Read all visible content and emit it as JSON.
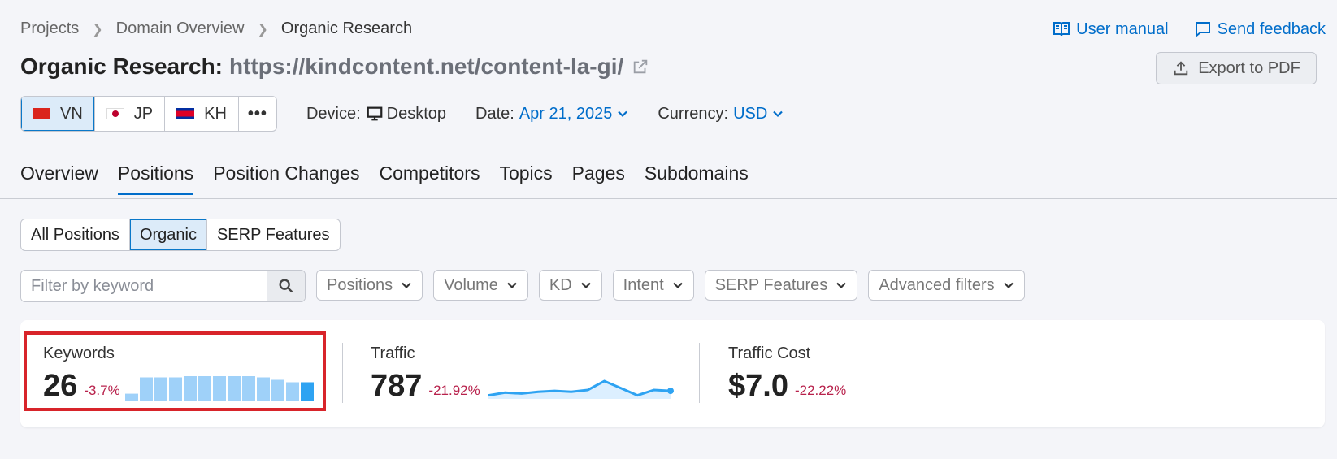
{
  "breadcrumb": {
    "items": [
      "Projects",
      "Domain Overview",
      "Organic Research"
    ]
  },
  "top_links": {
    "manual": "User manual",
    "feedback": "Send feedback"
  },
  "title": {
    "prefix": "Organic Research:",
    "url": "https://kindcontent.net/content-la-gi/"
  },
  "export_label": "Export to PDF",
  "databases": [
    {
      "code": "VN",
      "flag": "vn",
      "active": true
    },
    {
      "code": "JP",
      "flag": "jp",
      "active": false
    },
    {
      "code": "KH",
      "flag": "kh",
      "active": false
    }
  ],
  "more_label": "•••",
  "device": {
    "label": "Device:",
    "value": "Desktop",
    "icon": "monitor-icon"
  },
  "date": {
    "label": "Date:",
    "value": "Apr 21, 2025"
  },
  "currency": {
    "label": "Currency:",
    "value": "USD"
  },
  "tabs": [
    "Overview",
    "Positions",
    "Position Changes",
    "Competitors",
    "Topics",
    "Pages",
    "Subdomains"
  ],
  "active_tab": "Positions",
  "segments": [
    "All Positions",
    "Organic",
    "SERP Features"
  ],
  "active_segment": "Organic",
  "filter": {
    "placeholder": "Filter by keyword"
  },
  "dropdowns": [
    "Positions",
    "Volume",
    "KD",
    "Intent",
    "SERP Features",
    "Advanced filters"
  ],
  "metrics": {
    "keywords": {
      "label": "Keywords",
      "value": "26",
      "change": "-3.7%",
      "bars": [
        0.28,
        0.95,
        0.95,
        0.95,
        1.0,
        1.0,
        1.0,
        1.0,
        1.0,
        0.95,
        0.85,
        0.75,
        0.75
      ]
    },
    "traffic": {
      "label": "Traffic",
      "value": "787",
      "change": "-21.92%",
      "trend": [
        0.2,
        0.35,
        0.3,
        0.4,
        0.45,
        0.4,
        0.5,
        1.0,
        0.6,
        0.2,
        0.5,
        0.45
      ]
    },
    "cost": {
      "label": "Traffic Cost",
      "value": "$7.0",
      "change": "-22.22%"
    }
  },
  "colors": {
    "accent": "#006dca",
    "bar": "#9fd1f9",
    "bar_last": "#2ea3f2",
    "highlight": "#d8242a",
    "negative": "#b8224c"
  }
}
